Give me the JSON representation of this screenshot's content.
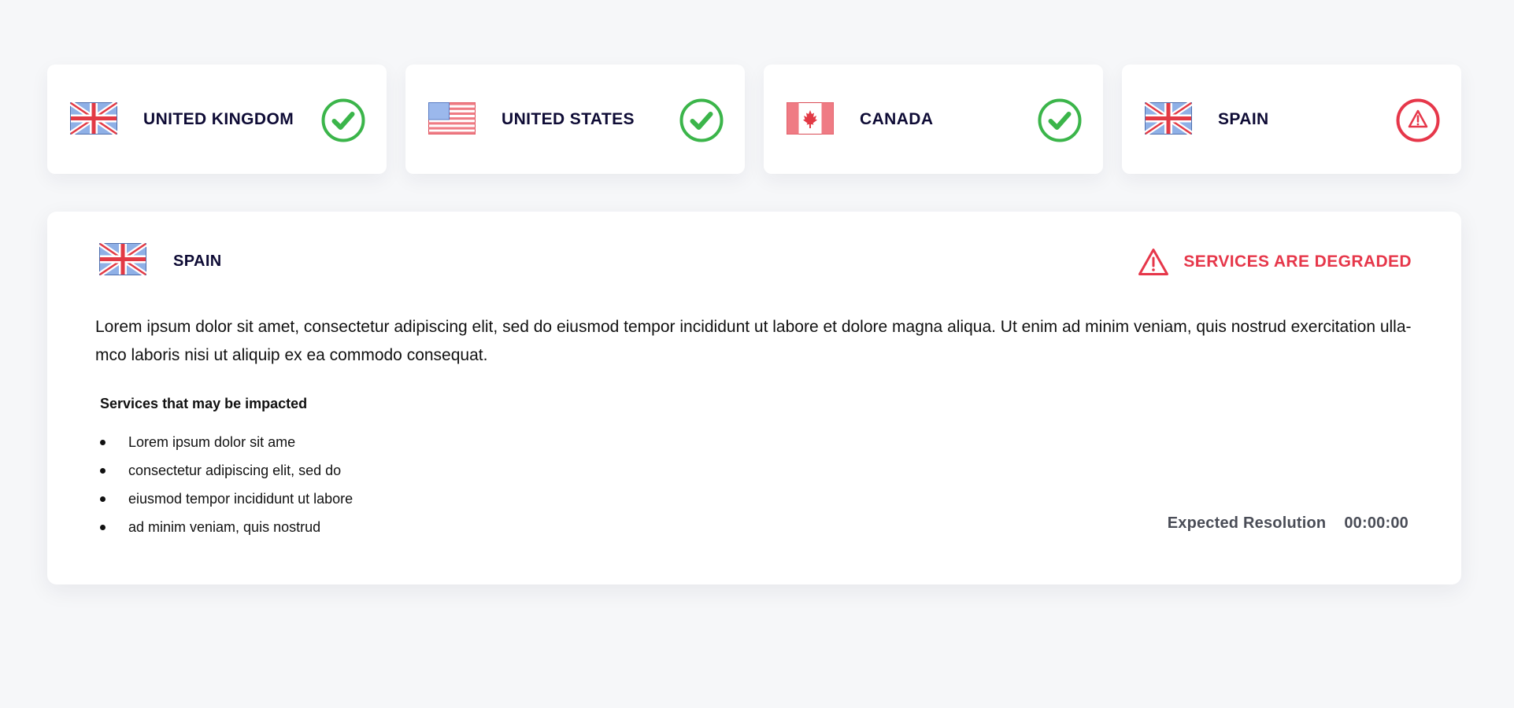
{
  "regions": [
    {
      "name": "UNITED KINGDOM",
      "flag": "uk-flag-icon",
      "status": "operational",
      "status_icon": "check-circle-icon"
    },
    {
      "name": "UNITED STATES",
      "flag": "us-flag-icon",
      "status": "operational",
      "status_icon": "check-circle-icon"
    },
    {
      "name": "CANADA",
      "flag": "canada-flag-icon",
      "status": "operational",
      "status_icon": "check-circle-icon"
    },
    {
      "name": "SPAIN",
      "flag": "uk-flag-icon",
      "status": "degraded",
      "status_icon": "warning-circle-icon"
    }
  ],
  "detail": {
    "region_name": "SPAIN",
    "flag": "uk-flag-icon",
    "alert_text": "SERVICES ARE DEGRADED",
    "description": "Lorem ipsum dolor sit amet, consectetur adipiscing elit, sed do eiusmod tempor incididunt ut labore et dolore magna aliqua. Ut enim ad minim veniam, quis nostrud exercitation ulla-mco laboris nisi ut aliquip ex ea commodo consequat.",
    "services_heading": "Services that may be impacted",
    "services": [
      "Lorem ipsum dolor sit ame",
      "consectetur adipiscing elit, sed do",
      "eiusmod tempor incididunt ut labore",
      "ad minim veniam, quis nostrud"
    ],
    "resolution_label": "Expected Resolution",
    "resolution_value": "00:00:00"
  },
  "colors": {
    "ok": "#3bb54a",
    "alert": "#e6374a",
    "title": "#0e0b35",
    "background": "#f6f7f9"
  }
}
